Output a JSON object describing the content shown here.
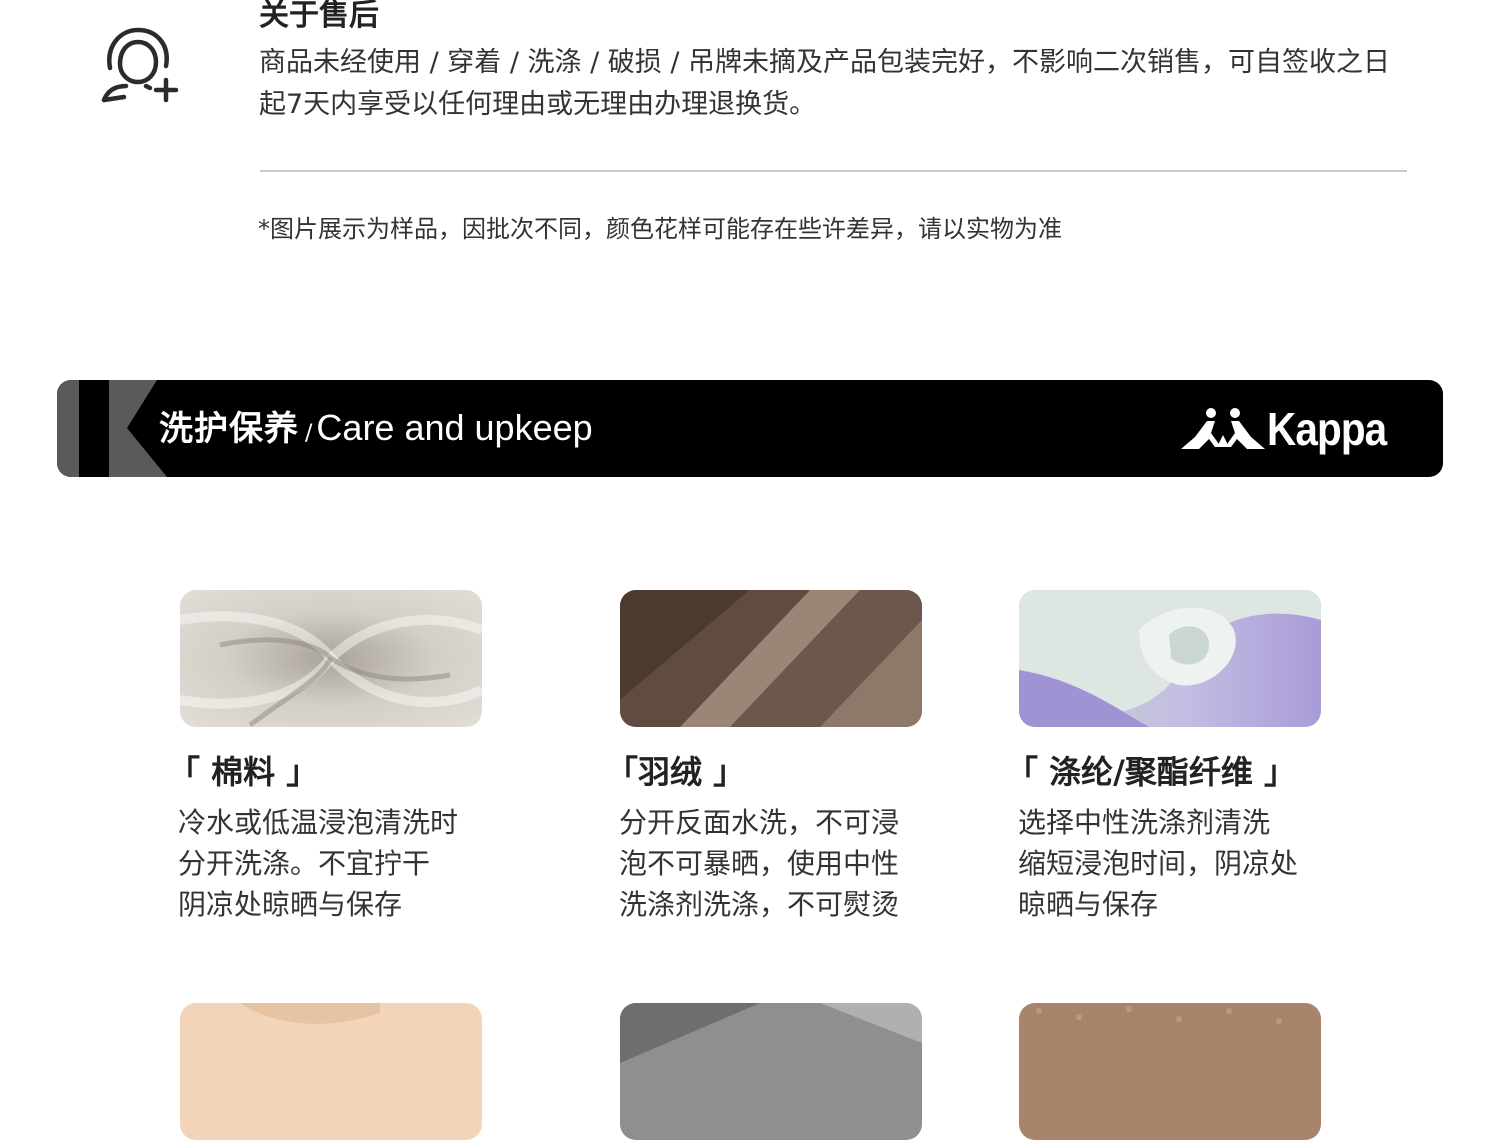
{
  "after_sales": {
    "title": "关于售后",
    "body": "商品未经使用 / 穿着 / 洗涤 / 破损 / 吊牌未摘及产品包装完好，不影响二次销售，可自签收之日起7天内享受以任何理由或无理由办理退换货。",
    "icon": "customer-service-add-icon"
  },
  "disclaimer": "*图片展示为样品，因批次不同，颜色花样可能存在些许差异，请以实物为准",
  "care_banner": {
    "title_cn": "洗护保养",
    "separator": "/",
    "title_en": "Care and upkeep",
    "brand": "Kappa",
    "background": "#000000",
    "accent": "#5a5a5a"
  },
  "fabrics": [
    {
      "name": "「 棉料 」",
      "lines": [
        "冷水或低温浸泡清洗时",
        "分开洗涤。不宜拧干",
        "阴凉处晾晒与保存"
      ],
      "swatch_color": "#d8d3cc"
    },
    {
      "name": "「羽绒 」",
      "lines": [
        "分开反面水洗，不可浸",
        "泡不可暴晒，使用中性",
        "洗涤剂洗涤，不可熨烫"
      ],
      "swatch_color": "#7a6558"
    },
    {
      "name": "「 涤纶/聚酯纤维 」",
      "lines": [
        "选择中性洗涤剂清洗",
        "缩短浸泡时间，阴凉处",
        "晾晒与保存"
      ],
      "swatch_color": "#b7a9e0"
    }
  ],
  "next_row_swatches": [
    "#f2d5b8",
    "#8f8f8f",
    "#a8846d"
  ]
}
